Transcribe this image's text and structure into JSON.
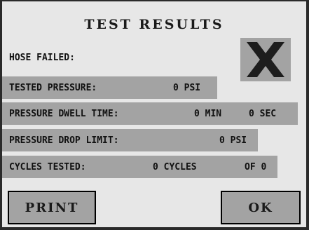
{
  "title": "TEST RESULTS",
  "status": {
    "label": "HOSE FAILED:",
    "result_icon": "x-mark-icon"
  },
  "rows": [
    {
      "label": "TESTED PRESSURE:",
      "value": "0 PSI"
    },
    {
      "label": "PRESSURE DWELL TIME:",
      "value": "0 MIN",
      "value2": "0 SEC"
    },
    {
      "label": "PRESSURE DROP LIMIT:",
      "value": "0 PSI"
    },
    {
      "label": "CYCLES TESTED:",
      "value": "0 CYCLES",
      "value2": "OF 0"
    }
  ],
  "buttons": {
    "print": "PRINT",
    "ok": "OK"
  },
  "colors": {
    "background": "#e7e7e7",
    "band": "#a3a3a3",
    "text": "#111111"
  }
}
